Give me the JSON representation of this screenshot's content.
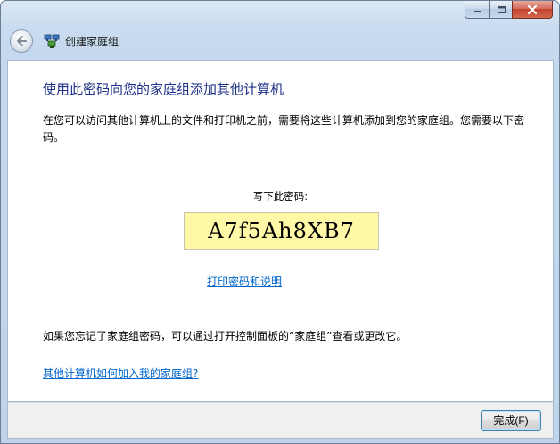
{
  "window": {
    "title": "创建家庭组"
  },
  "main": {
    "heading": "使用此密码向您的家庭组添加其他计算机",
    "intro": "在您可以访问其他计算机上的文件和打印机之前，需要将这些计算机添加到您的家庭组。您需要以下密码。",
    "password_label": "写下此密码:",
    "password": "A7f5Ah8XB7",
    "print_link": "打印密码和说明",
    "forgot_text": "如果您忘记了家庭组密码，可以通过打开控制面板的“家庭组”查看或更改它。",
    "help_link": "其他计算机如何加入我的家庭组?"
  },
  "footer": {
    "finish_label": "完成(F)"
  },
  "colors": {
    "heading": "#1e3287",
    "link": "#0066cc",
    "password_bg": "#fff8a6"
  }
}
